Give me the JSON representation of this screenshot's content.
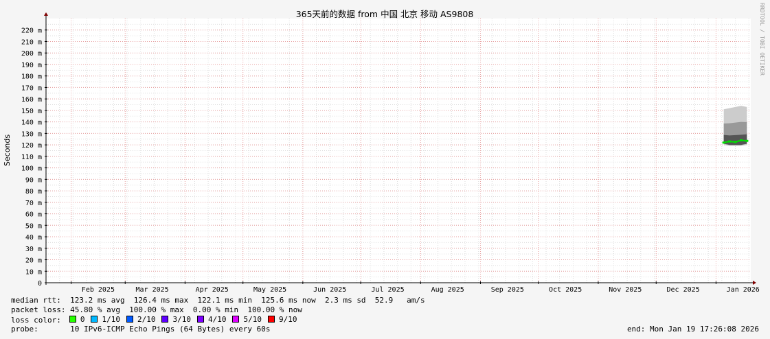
{
  "chart_data": {
    "type": "line",
    "title": "365天前的数据 from 中国 北京 移动 AS9808",
    "ylabel": "Seconds",
    "watermark": "RRDTOOL / TOBI OETIKER",
    "ylim": [
      0,
      230
    ],
    "y_ticks": [
      {
        "value": 0,
        "label": "0"
      },
      {
        "value": 10,
        "label": "10 m"
      },
      {
        "value": 20,
        "label": "20 m"
      },
      {
        "value": 30,
        "label": "30 m"
      },
      {
        "value": 40,
        "label": "40 m"
      },
      {
        "value": 50,
        "label": "50 m"
      },
      {
        "value": 60,
        "label": "60 m"
      },
      {
        "value": 70,
        "label": "70 m"
      },
      {
        "value": 80,
        "label": "80 m"
      },
      {
        "value": 90,
        "label": "90 m"
      },
      {
        "value": 100,
        "label": "100 m"
      },
      {
        "value": 110,
        "label": "110 m"
      },
      {
        "value": 120,
        "label": "120 m"
      },
      {
        "value": 130,
        "label": "130 m"
      },
      {
        "value": 140,
        "label": "140 m"
      },
      {
        "value": 150,
        "label": "150 m"
      },
      {
        "value": 160,
        "label": "160 m"
      },
      {
        "value": 170,
        "label": "170 m"
      },
      {
        "value": 180,
        "label": "180 m"
      },
      {
        "value": 190,
        "label": "190 m"
      },
      {
        "value": 200,
        "label": "200 m"
      },
      {
        "value": 210,
        "label": "210 m"
      },
      {
        "value": 220,
        "label": "220 m"
      }
    ],
    "xlim": [
      "2025-01-19",
      "2026-01-19"
    ],
    "x_ticks": [
      {
        "date": "2025-02-15",
        "label": "Feb 2025"
      },
      {
        "date": "2025-03-15",
        "label": "Mar 2025"
      },
      {
        "date": "2025-04-15",
        "label": "Apr 2025"
      },
      {
        "date": "2025-05-15",
        "label": "May 2025"
      },
      {
        "date": "2025-06-15",
        "label": "Jun 2025"
      },
      {
        "date": "2025-07-15",
        "label": "Jul 2025"
      },
      {
        "date": "2025-08-15",
        "label": "Aug 2025"
      },
      {
        "date": "2025-09-15",
        "label": "Sep 2025"
      },
      {
        "date": "2025-10-15",
        "label": "Oct 2025"
      },
      {
        "date": "2025-11-15",
        "label": "Nov 2025"
      },
      {
        "date": "2025-12-15",
        "label": "Dec 2025"
      },
      {
        "date": "2026-01-15",
        "label": "Jan 2026"
      }
    ],
    "month_starts": [
      "2025-02-01",
      "2025-03-01",
      "2025-04-01",
      "2025-05-01",
      "2025-06-01",
      "2025-07-01",
      "2025-08-01",
      "2025-09-01",
      "2025-10-01",
      "2025-11-01",
      "2025-12-01",
      "2026-01-01"
    ],
    "smoke_band": [
      {
        "date": "2026-01-05",
        "low": 120,
        "high": 151
      },
      {
        "date": "2026-01-08",
        "low": 119,
        "high": 152
      },
      {
        "date": "2026-01-11",
        "low": 119,
        "high": 153
      },
      {
        "date": "2026-01-14",
        "low": 119,
        "high": 154
      },
      {
        "date": "2026-01-17",
        "low": 120,
        "high": 153
      }
    ],
    "median_series": {
      "color": "#00e000",
      "points": [
        {
          "date": "2026-01-05",
          "value": 122
        },
        {
          "date": "2026-01-08",
          "value": 123
        },
        {
          "date": "2026-01-11",
          "value": 122.5
        },
        {
          "date": "2026-01-14",
          "value": 124
        },
        {
          "date": "2026-01-17",
          "value": 123.5
        }
      ]
    },
    "grid": true
  },
  "legend": {
    "median_rtt": "median rtt:  123.2 ms avg  126.4 ms max  122.1 ms min  125.6 ms now  2.3 ms sd  52.9   am/s",
    "packet_loss": "packet loss: 45.80 % avg  100.00 % max  0.00 % min  100.00 % now",
    "loss_color_label": "loss color:",
    "loss_colors": [
      {
        "label": "0",
        "color": "#26ff00"
      },
      {
        "label": "1/10",
        "color": "#00b8ff"
      },
      {
        "label": "2/10",
        "color": "#0059ff"
      },
      {
        "label": "3/10",
        "color": "#5e00ff"
      },
      {
        "label": "4/10",
        "color": "#7e00ff"
      },
      {
        "label": "5/10",
        "color": "#dd00ff"
      },
      {
        "label": "9/10",
        "color": "#ff0000"
      }
    ],
    "probe": "probe:       10 IPv6-ICMP Echo Pings (64 Bytes) every 60s",
    "end": "end: Mon Jan 19 17:26:08 2026"
  }
}
